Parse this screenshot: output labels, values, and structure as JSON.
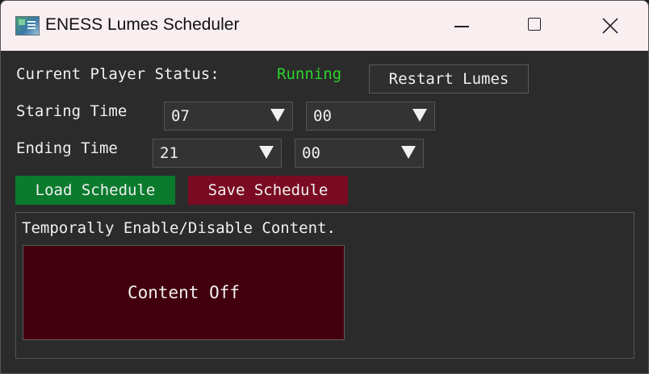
{
  "window": {
    "title": "ENESS Lumes Scheduler",
    "icons": [
      "app-icon",
      "minimize-icon",
      "maximize-icon",
      "close-icon"
    ]
  },
  "status": {
    "label": "Current Player Status:",
    "value": "Running",
    "value_color": "#2bd52b",
    "restart_label": "Restart Lumes"
  },
  "starting": {
    "label": "Staring Time",
    "hour": "07",
    "minute": "00"
  },
  "ending": {
    "label": "Ending Time",
    "hour": "21",
    "minute": "00"
  },
  "schedule": {
    "load_label": "Load Schedule",
    "save_label": "Save Schedule",
    "load_color": "#0a7a2d",
    "save_color": "#7a0a22"
  },
  "panel": {
    "heading": "Temporally Enable/Disable Content.",
    "toggle_label": "Content Off",
    "toggle_color": "#42000e"
  }
}
